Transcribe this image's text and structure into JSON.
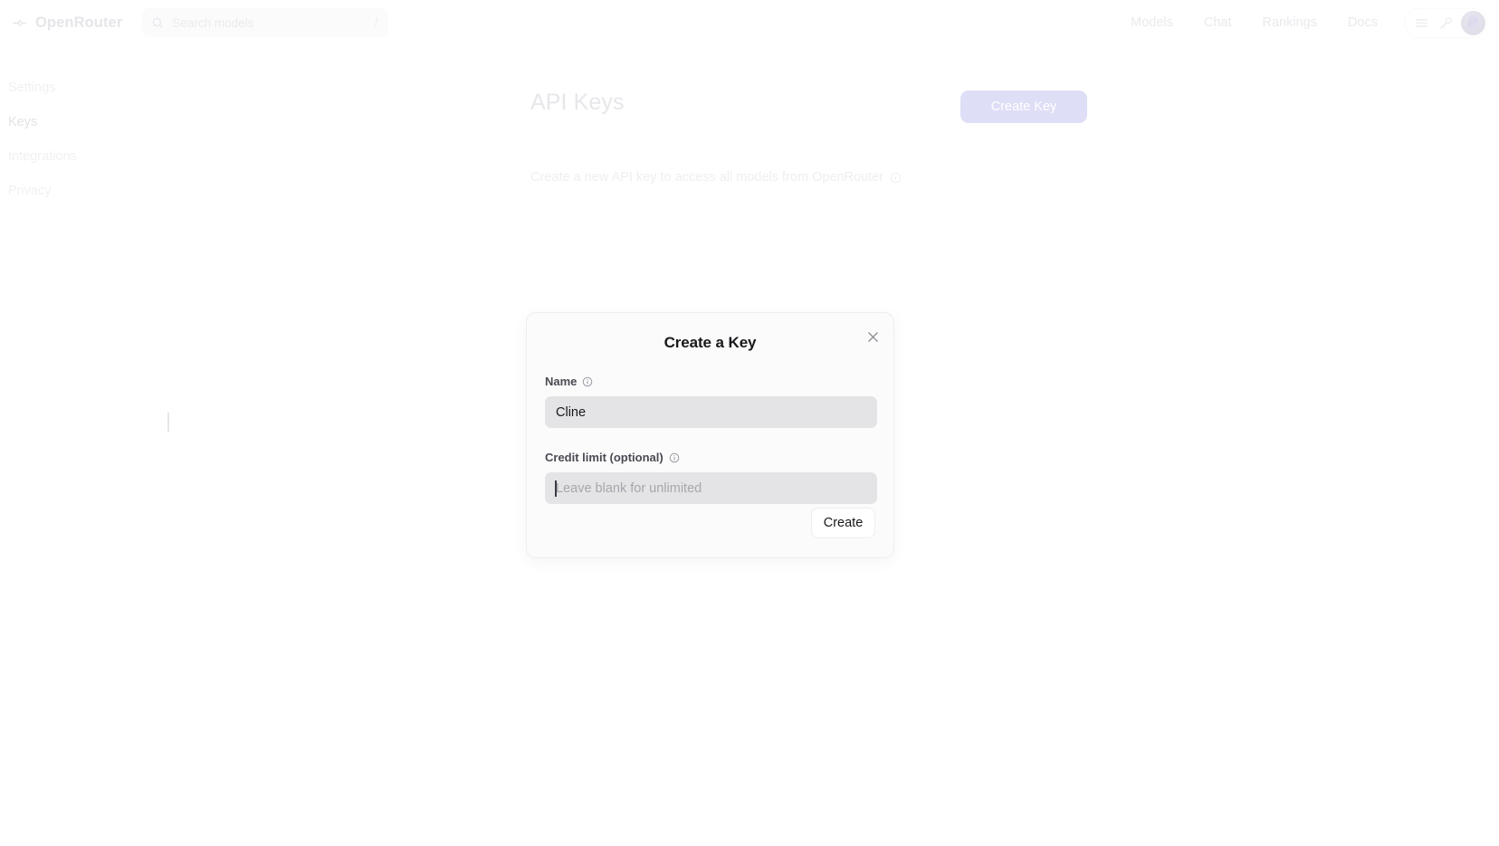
{
  "topnav": {
    "brand": "OpenRouter",
    "brand_logo_icon": "openrouter-logo-icon",
    "search": {
      "placeholder": "Search models",
      "icon": "search-icon",
      "shortcut": "/"
    },
    "links": [
      {
        "label": "Models"
      },
      {
        "label": "Chat"
      },
      {
        "label": "Rankings"
      },
      {
        "label": "Docs"
      }
    ],
    "pill": {
      "menu_icon": "hamburger-menu-icon",
      "key_icon": "key-icon",
      "avatar_icon": "avatar"
    }
  },
  "sidebar": {
    "items": [
      {
        "label": "Settings",
        "active": false
      },
      {
        "label": "Keys",
        "active": true
      },
      {
        "label": "Integrations",
        "active": false
      },
      {
        "label": "Privacy",
        "active": false
      }
    ]
  },
  "main": {
    "title": "API Keys",
    "create_key_label": "Create Key",
    "subtext": "Create a new API key to access all models from OpenRouter",
    "subtext_info_icon": "info-circle-icon"
  },
  "modal": {
    "title": "Create a Key",
    "close_icon": "close-x-icon",
    "name_field": {
      "label": "Name",
      "info_icon": "info-circle-icon",
      "value": "Cline",
      "placeholder": ""
    },
    "credit_field": {
      "label": "Credit limit (optional)",
      "info_icon": "info-circle-icon",
      "value": "",
      "placeholder": "Leave blank for unlimited"
    },
    "submit_label": "Create"
  },
  "colors": {
    "accent_purple": "#dedef7",
    "input_gray": "#e4e4e7",
    "modal_bg": "#fbfbfc",
    "text_primary": "#18181b"
  }
}
